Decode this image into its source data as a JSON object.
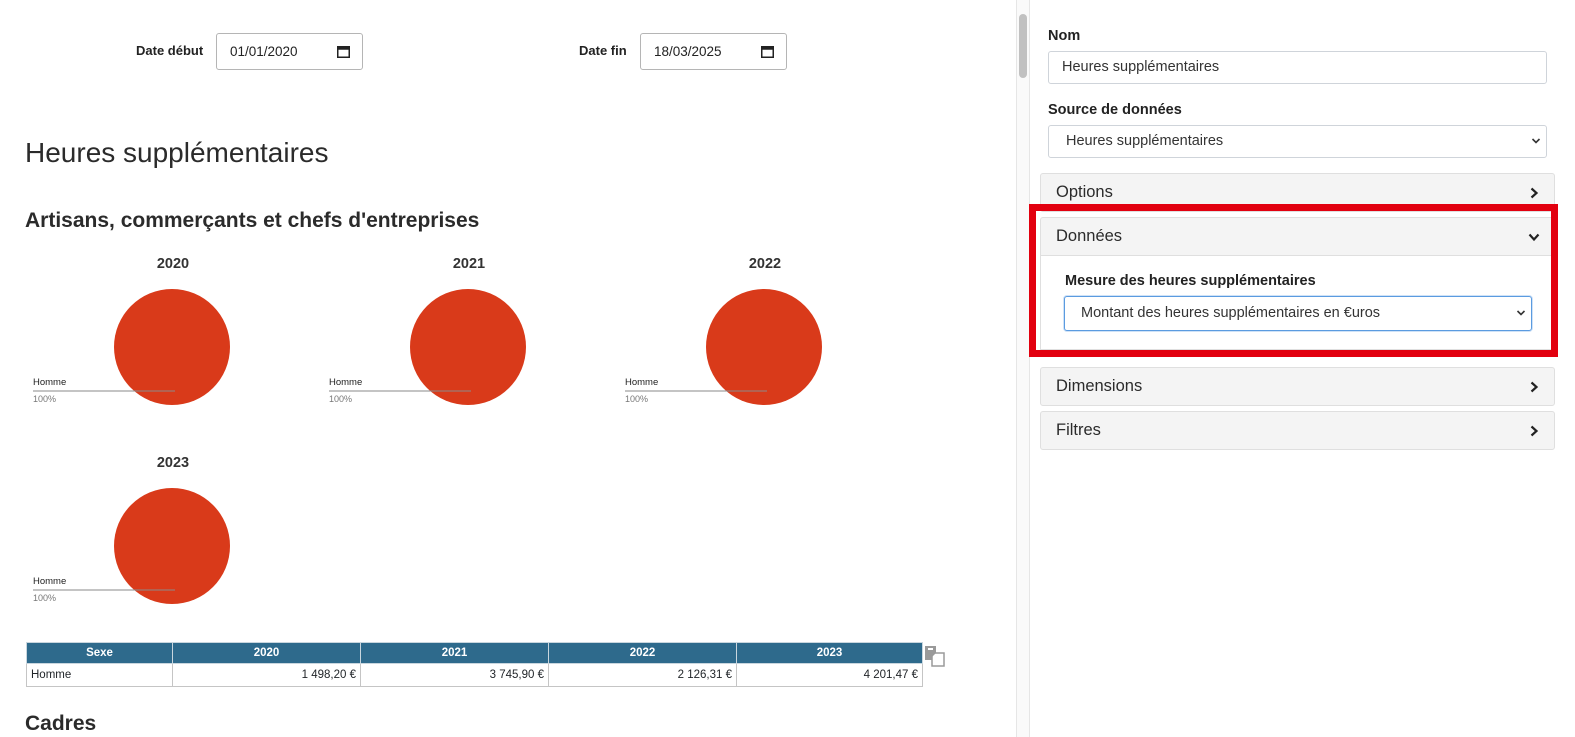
{
  "filters": {
    "start_label": "Date début",
    "start_value": "01/01/2020",
    "end_label": "Date fin",
    "end_value": "18/03/2025"
  },
  "main": {
    "title": "Heures supplémentaires",
    "section_1": "Artisans, commerçants et chefs d'entreprises",
    "section_2": "Cadres"
  },
  "chart_data": [
    {
      "type": "pie",
      "title": "2020",
      "categories": [
        "Homme"
      ],
      "values": [
        100
      ],
      "labels": [
        "100%"
      ],
      "colors": [
        "#d93a1a"
      ]
    },
    {
      "type": "pie",
      "title": "2021",
      "categories": [
        "Homme"
      ],
      "values": [
        100
      ],
      "labels": [
        "100%"
      ],
      "colors": [
        "#d93a1a"
      ]
    },
    {
      "type": "pie",
      "title": "2022",
      "categories": [
        "Homme"
      ],
      "values": [
        100
      ],
      "labels": [
        "100%"
      ],
      "colors": [
        "#d93a1a"
      ]
    },
    {
      "type": "pie",
      "title": "2023",
      "categories": [
        "Homme"
      ],
      "values": [
        100
      ],
      "labels": [
        "100%"
      ],
      "colors": [
        "#d93a1a"
      ]
    }
  ],
  "table": {
    "headers": [
      "Sexe",
      "2020",
      "2021",
      "2022",
      "2023"
    ],
    "rows": [
      [
        "Homme",
        "1 498,20 €",
        "3 745,90 €",
        "2 126,31 €",
        "4 201,47 €"
      ]
    ]
  },
  "panel": {
    "name_label": "Nom",
    "name_value": "Heures supplémentaires",
    "source_label": "Source de données",
    "source_value": "Heures supplémentaires",
    "sections": [
      "Options",
      "Données",
      "Dimensions",
      "Filtres"
    ],
    "measure_label": "Mesure des heures supplémentaires",
    "measure_value": "Montant des heures supplémentaires en €uros"
  },
  "colors": {
    "pie": "#d93a1a",
    "table_header": "#2e6a8c",
    "highlight": "#e2000f",
    "focus_border": "#5b9be0"
  },
  "icons": {
    "date_picker": "calendar-icon",
    "collapsed": "chevron-right-icon",
    "expanded": "chevron-down-icon",
    "copy": "copy-icon"
  }
}
